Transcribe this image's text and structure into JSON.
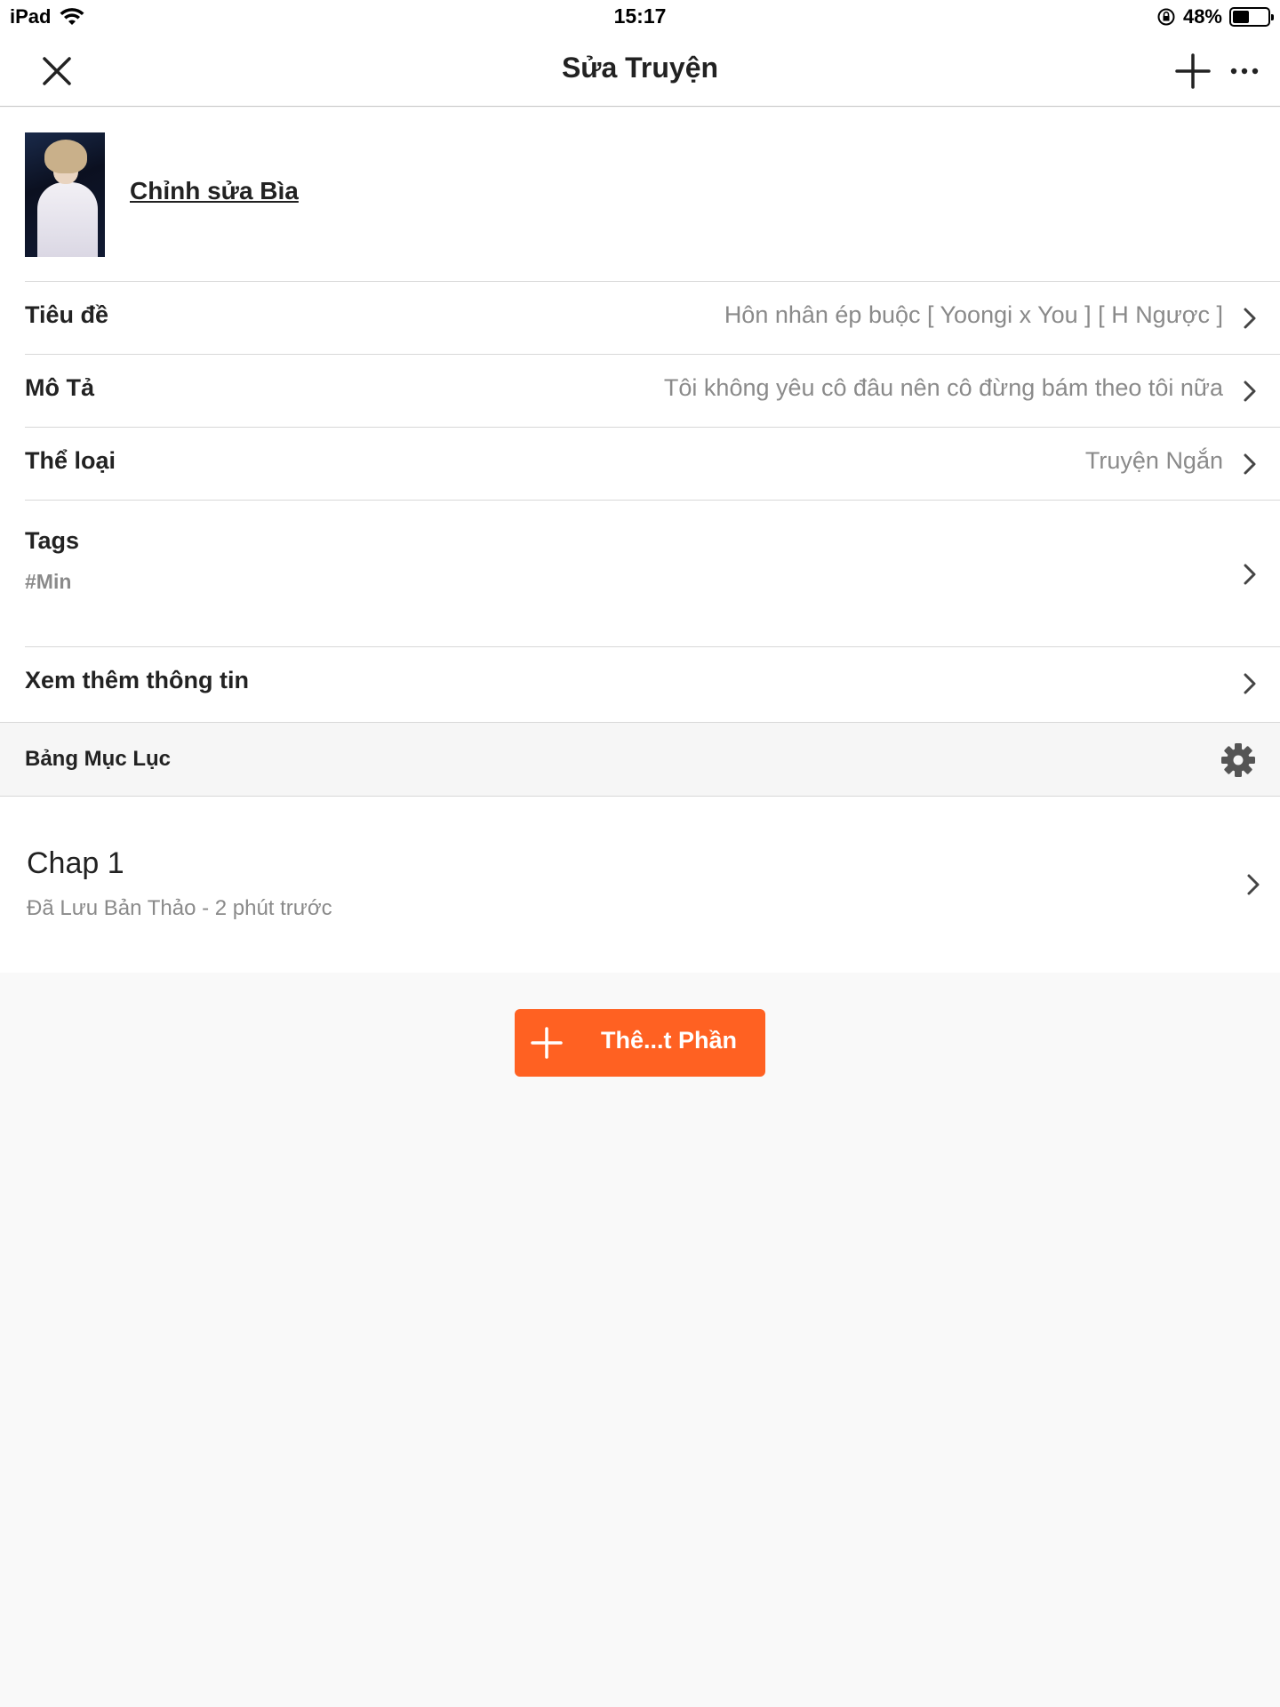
{
  "status_bar": {
    "device": "iPad",
    "time": "15:17",
    "battery_text": "48%",
    "battery_level": 0.48
  },
  "nav": {
    "title": "Sửa Truyện",
    "close_icon": "close-icon",
    "add_icon": "plus-icon",
    "more_icon": "more-icon"
  },
  "cover": {
    "edit_label": "Chỉnh sửa Bìa"
  },
  "fields": {
    "title": {
      "label": "Tiêu đề",
      "value": "Hôn nhân ép buộc [ Yoongi x You ] [ H Ngược ]"
    },
    "description": {
      "label": "Mô Tả",
      "value": "Tôi không yêu cô đâu nên cô đừng bám theo tôi nữa"
    },
    "genre": {
      "label": "Thể loại",
      "value": "Truyện Ngắn"
    },
    "tags": {
      "label": "Tags",
      "value": "#Min"
    },
    "more_info": {
      "label": "Xem thêm thông tin"
    }
  },
  "toc": {
    "label": "Bảng Mục Lục",
    "settings_icon": "gear-icon"
  },
  "chapters": [
    {
      "title": "Chap 1",
      "status": "Đã Lưu Bản Thảo - 2 phút trước"
    }
  ],
  "add_part": {
    "label": "Thê...t Phần",
    "color": "#ff6122"
  }
}
